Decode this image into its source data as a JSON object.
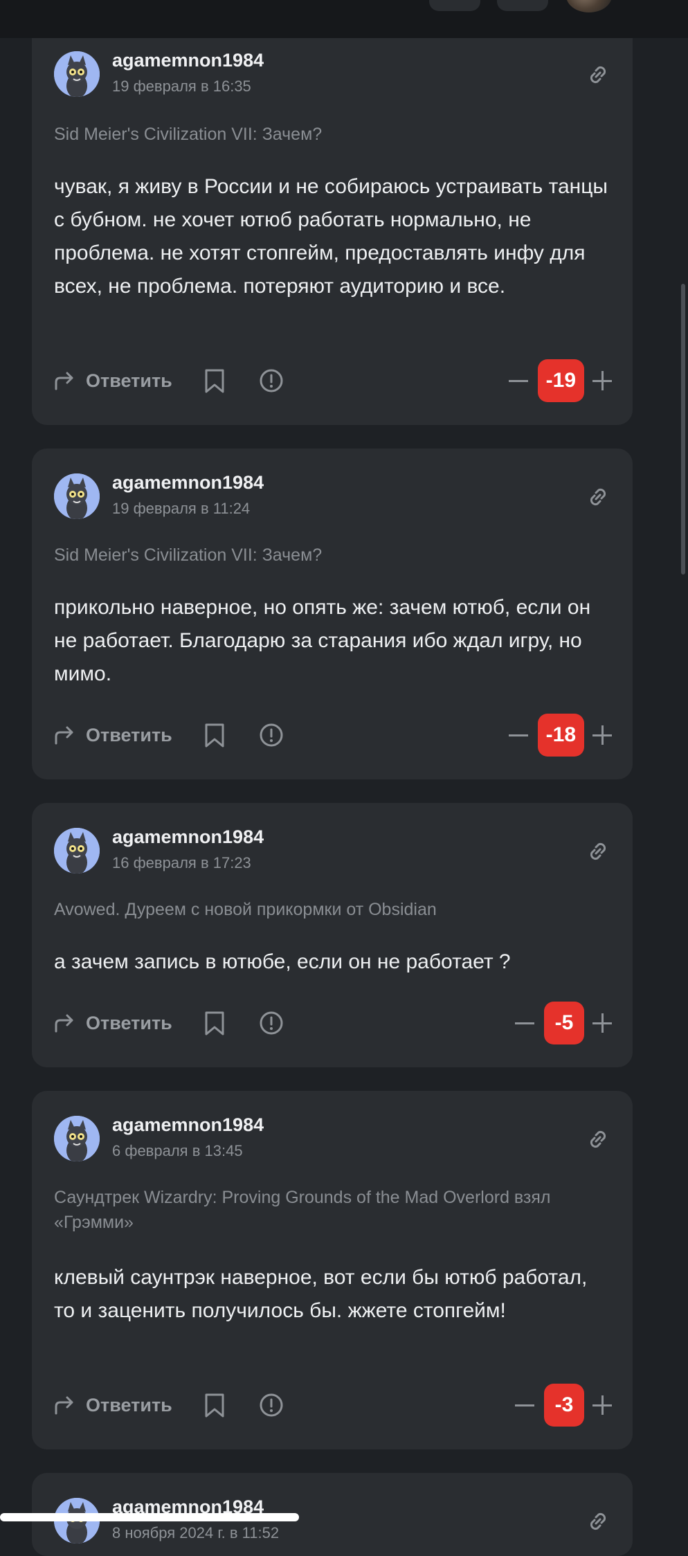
{
  "comments": [
    {
      "username": "agamemnon1984",
      "date": "19 февраля в 16:35",
      "topic": "Sid Meier's Civilization VII: Зачем?",
      "body": "чувак, я живу в России и не собираюсь устраивать танцы с бубном. не хочет ютюб работать нормально, не проблема. не хотят стопгейм, предоставлять инфу для всех, не проблема. потеряют аудиторию и все.",
      "reply_label": "Ответить",
      "score": "-19"
    },
    {
      "username": "agamemnon1984",
      "date": "19 февраля в 11:24",
      "topic": "Sid Meier's Civilization VII: Зачем?",
      "body": "прикольно наверное, но опять же: зачем ютюб, если он не работает. Благодарю за старания ибо ждал игру, но мимо.",
      "reply_label": "Ответить",
      "score": "-18"
    },
    {
      "username": "agamemnon1984",
      "date": "16 февраля в 17:23",
      "topic": "Avowed. Дуреем с новой прикормки от Obsidian",
      "body": "а зачем запись в ютюбе, если он не работает ?",
      "reply_label": "Ответить",
      "score": "-5"
    },
    {
      "username": "agamemnon1984",
      "date": "6 февраля в 13:45",
      "topic": "Саундтрек Wizardry: Proving Grounds of the Mad Overlord взял «Грэмми»",
      "body": "клевый саунтрэк наверное, вот если бы ютюб работал, то и заценить получилось бы. жжете стопгейм!",
      "reply_label": "Ответить",
      "score": "-3"
    },
    {
      "username": "agamemnon1984",
      "date": "8 ноября 2024 г. в 11:52"
    }
  ],
  "colors": {
    "background": "#1e2125",
    "card": "#2a2d31",
    "score_negative": "#e5322b"
  }
}
